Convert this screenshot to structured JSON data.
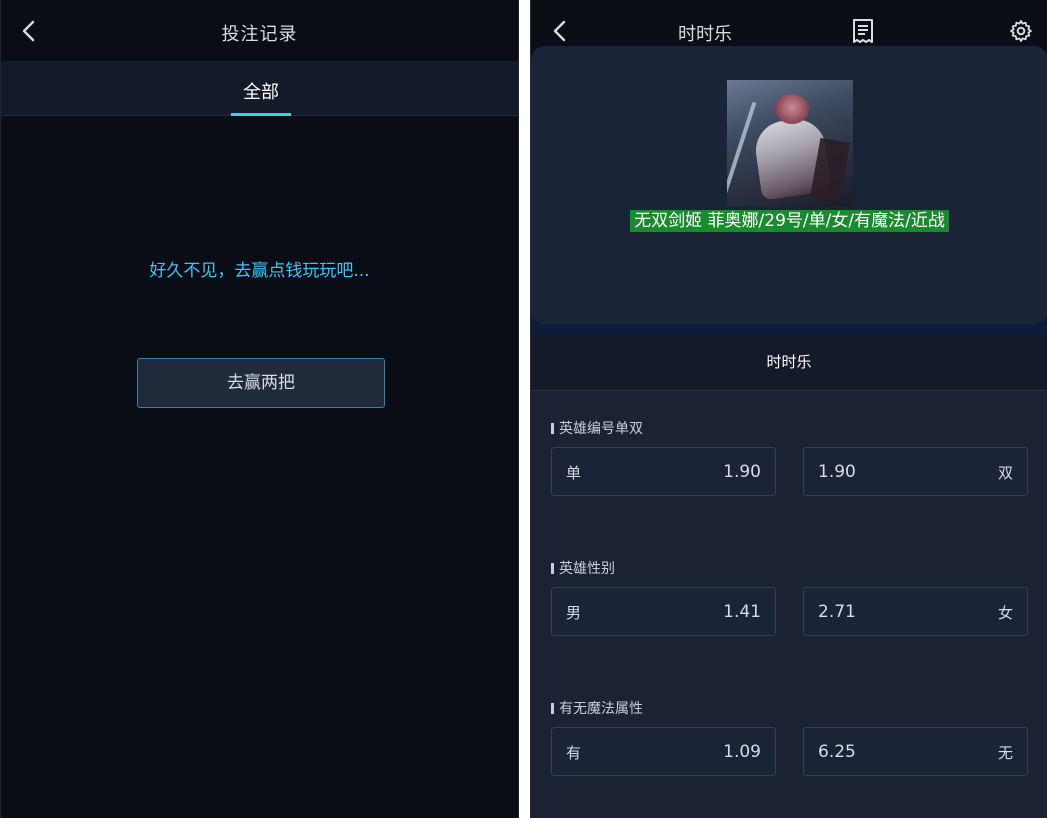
{
  "left_panel": {
    "header_title": "投注记录",
    "tabs": [
      {
        "label": "全部",
        "active": true
      }
    ],
    "empty_message": "好久不见，去赢点钱玩玩吧...",
    "cta_button_label": "去赢两把"
  },
  "right_panel": {
    "header_title": "时时乐",
    "hero_name": "无双剑姬 菲奥娜/29号/单/女/有魔法/近战",
    "section_title": "时时乐",
    "groups": [
      {
        "label": "英雄编号单双",
        "options": [
          {
            "label": "单",
            "odds": "1.90"
          },
          {
            "label": "双",
            "odds": "1.90"
          }
        ]
      },
      {
        "label": "英雄性别",
        "options": [
          {
            "label": "男",
            "odds": "1.41"
          },
          {
            "label": "女",
            "odds": "2.71"
          }
        ]
      },
      {
        "label": "有无魔法属性",
        "options": [
          {
            "label": "有",
            "odds": "1.09"
          },
          {
            "label": "无",
            "odds": "6.25"
          }
        ]
      }
    ]
  },
  "colors": {
    "accent_cyan": "#2bd7f0",
    "message_blue": "#3fc6f5",
    "hero_name_bg": "#1a8a2e",
    "dark_bg": "#0b0d16",
    "panel_bg": "#1a2233"
  },
  "icons": [
    "chevron-left-icon",
    "receipt-icon",
    "gear-icon"
  ]
}
